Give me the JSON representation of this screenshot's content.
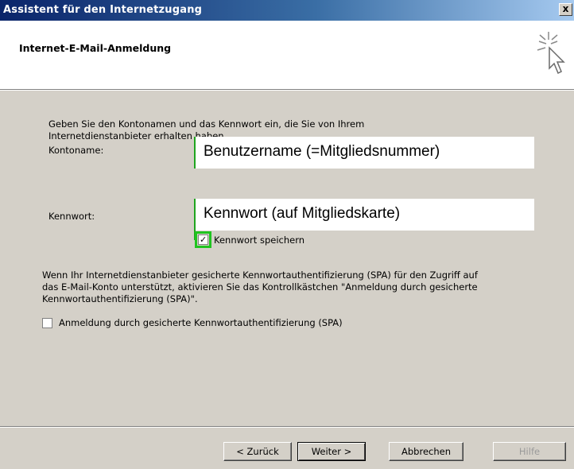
{
  "window": {
    "title": "Assistent für den Internetzugang",
    "close_label": "x"
  },
  "header": {
    "title": "Internet-E-Mail-Anmeldung",
    "icon": "wizard-cursor-icon"
  },
  "form": {
    "intro": "Geben Sie den Kontonamen und das Kennwort ein, die Sie von Ihrem Internetdienstanbieter erhalten haben.",
    "account_label": "Kontoname:",
    "account_value": "Benutzername (=Mitgliedsnummer)",
    "password_label": "Kennwort:",
    "password_value": "Kennwort (auf Mitgliedskarte)",
    "save_password_label": "Kennwort speichern",
    "save_password_checked": true,
    "spa_info": "Wenn Ihr Internetdienstanbieter gesicherte Kennwortauthentifizierung (SPA) für den Zugriff auf das E-Mail-Konto unterstützt, aktivieren Sie das Kontrollkästchen \"Anmeldung durch gesicherte Kennwortauthentifizierung (SPA)\".",
    "spa_label": "Anmeldung durch gesicherte Kennwortauthentifizierung (SPA)",
    "spa_checked": false
  },
  "buttons": {
    "back": "< Zurück",
    "next": "Weiter >",
    "cancel": "Abbrechen",
    "help": "Hilfe"
  },
  "colors": {
    "highlight": "#1fa51f",
    "titlebar_start": "#0a246a",
    "titlebar_end": "#a6caf0"
  }
}
